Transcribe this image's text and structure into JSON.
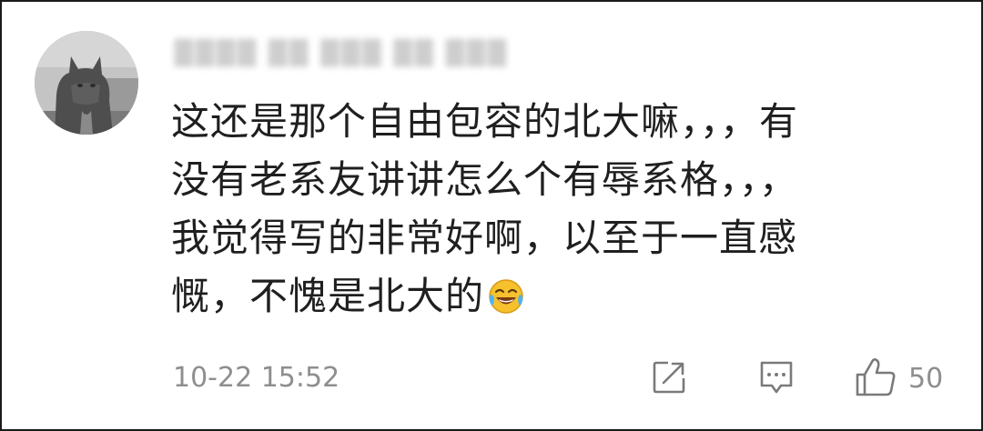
{
  "comment": {
    "username": "████ ██ ███ ██ ███",
    "lines": [
      "这还是那个自由包容的北大嘛，，，有",
      "没有老系友讲讲怎么个有辱系格，，，",
      "我觉得写的非常好啊，以至于一直感",
      "慨，不愧是北大的"
    ],
    "emoji": "laughing-tears-emoji",
    "timestamp": "10-22 15:52",
    "like_count": "50"
  },
  "icons": {
    "share": "share-icon",
    "reply": "comment-icon",
    "like": "thumbs-up-icon"
  },
  "colors": {
    "text": "#1f1f1f",
    "meta": "#8e8e8e",
    "border": "#1a1a1a"
  }
}
